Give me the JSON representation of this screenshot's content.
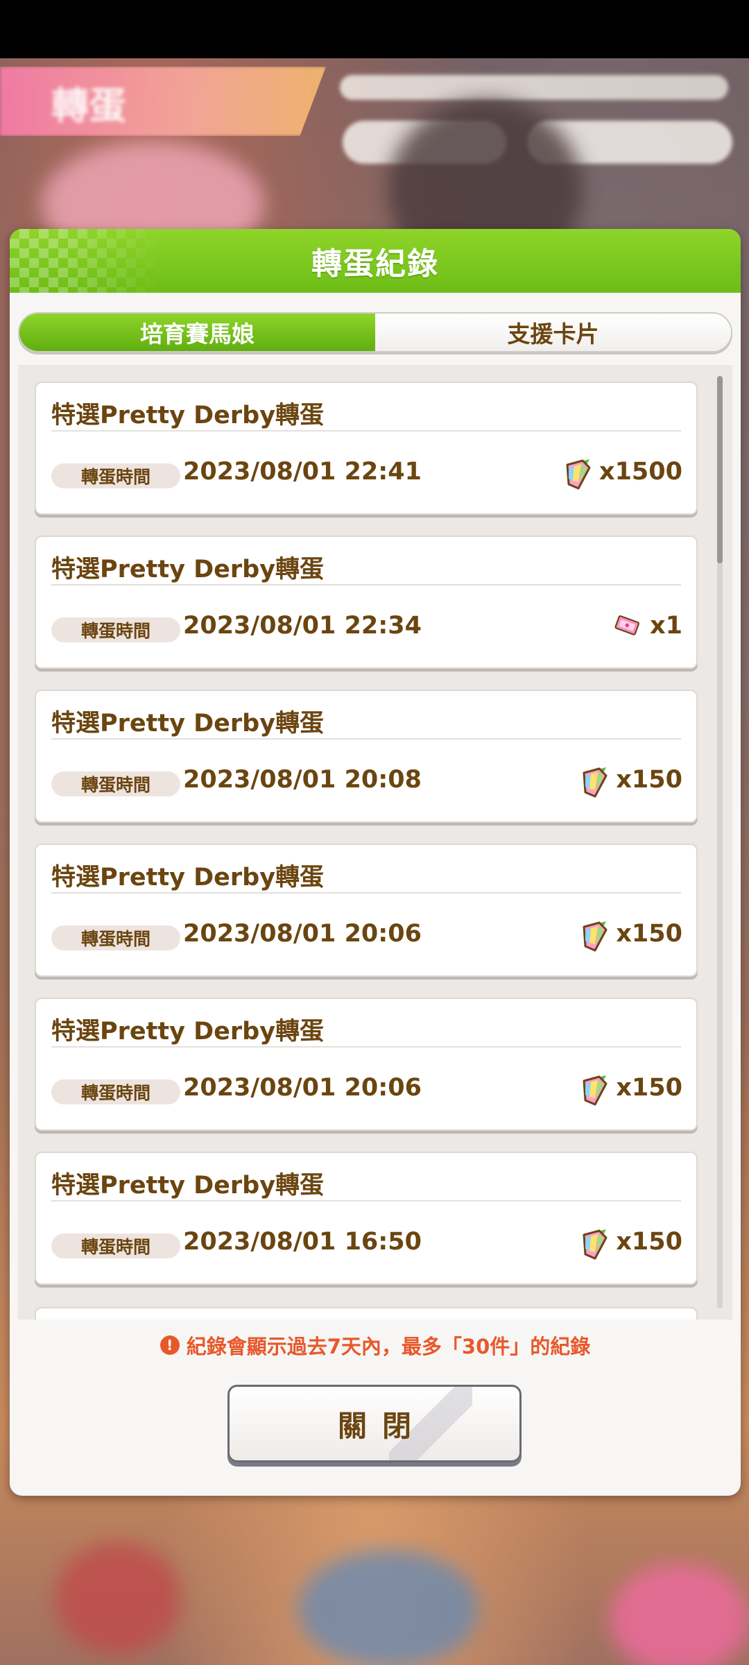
{
  "background": {
    "banner_title": "轉蛋"
  },
  "dialog": {
    "title": "轉蛋紀錄",
    "tabs": [
      {
        "label": "培育賽馬娘",
        "active": true
      },
      {
        "label": "支援卡片",
        "active": false
      }
    ],
    "time_label": "轉蛋時間",
    "records": [
      {
        "title": "特選Pretty Derby轉蛋",
        "time": "2023/08/01 22:41",
        "cost_icon": "carat-gem-icon",
        "cost": "x1500"
      },
      {
        "title": "特選Pretty Derby轉蛋",
        "time": "2023/08/01 22:34",
        "cost_icon": "gacha-ticket-icon",
        "cost": "x1"
      },
      {
        "title": "特選Pretty Derby轉蛋",
        "time": "2023/08/01 20:08",
        "cost_icon": "carat-gem-icon",
        "cost": "x150"
      },
      {
        "title": "特選Pretty Derby轉蛋",
        "time": "2023/08/01 20:06",
        "cost_icon": "carat-gem-icon",
        "cost": "x150"
      },
      {
        "title": "特選Pretty Derby轉蛋",
        "time": "2023/08/01 20:06",
        "cost_icon": "carat-gem-icon",
        "cost": "x150"
      },
      {
        "title": "特選Pretty Derby轉蛋",
        "time": "2023/08/01 16:50",
        "cost_icon": "carat-gem-icon",
        "cost": "x150"
      }
    ],
    "notice": "紀錄會顯示過去7天內，最多「30件」的紀錄",
    "notice_icon": "!",
    "close_label": "關閉"
  },
  "colors": {
    "header_green": "#7ac61e",
    "text_brown": "#6b4510",
    "notice_orange": "#e8582a"
  }
}
